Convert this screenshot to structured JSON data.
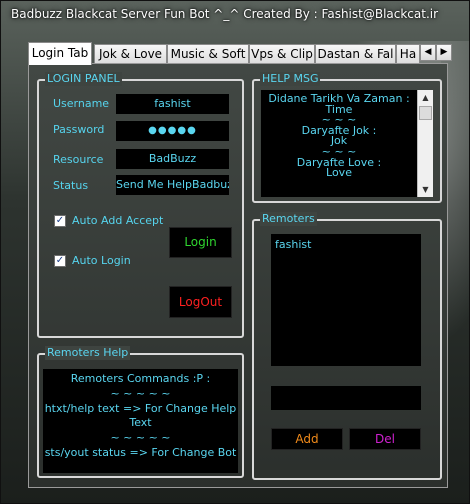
{
  "window": {
    "title": "Badbuzz Blackcat Server Fun Bot  ^_^ Created By : Fashist@Blackcat.ir"
  },
  "tabs": [
    {
      "label": "Login Tab"
    },
    {
      "label": "Jok & Love"
    },
    {
      "label": "Music & Soft"
    },
    {
      "label": "Vps & Clip"
    },
    {
      "label": "Dastan & Fal"
    },
    {
      "label": "Ha"
    }
  ],
  "tab_scroll": {
    "left": "◀",
    "right": "▶"
  },
  "login_panel": {
    "title": "LOGIN PANEL",
    "username_label": "Username",
    "username_value": "fashist",
    "password_label": "Password",
    "password_value": "●●●●●",
    "resource_label": "Resource",
    "resource_value": "BadBuzz",
    "status_label": "Status",
    "status_value": "Send Me HelpBadbuzz",
    "auto_add_accept": {
      "label": "Auto Add Accept",
      "checked": true,
      "mark": "✓"
    },
    "auto_login": {
      "label": "Auto Login",
      "checked": true,
      "mark": "✓"
    },
    "login_button": "Login",
    "logout_button": "LogOut"
  },
  "help_msg": {
    "title": "HELP MSG",
    "lines": [
      "Didane Tarikh Va Zaman :",
      "Time",
      "~ ~ ~",
      "Daryafte Jok :",
      "Jok",
      "~ ~ ~",
      "Daryafte Love :",
      "Love"
    ]
  },
  "remoters": {
    "title": "Remoters",
    "list": [
      "fashist"
    ],
    "input_value": "",
    "add_button": "Add",
    "del_button": "Del"
  },
  "remoters_help": {
    "title": "Remoters Help",
    "lines": [
      "Remoters Commands :P :",
      "~ ~ ~ ~ ~",
      "htxt/help text => For Change Help",
      "Text",
      "~ ~ ~ ~ ~",
      "sts/yout status => For Change Bot"
    ]
  },
  "colors": {
    "accent_cyan": "#5ad6f0",
    "login_green": "#2fd52f",
    "logout_red": "#ff2020",
    "add_orange": "#f08a1a",
    "del_magenta": "#d020d0"
  }
}
